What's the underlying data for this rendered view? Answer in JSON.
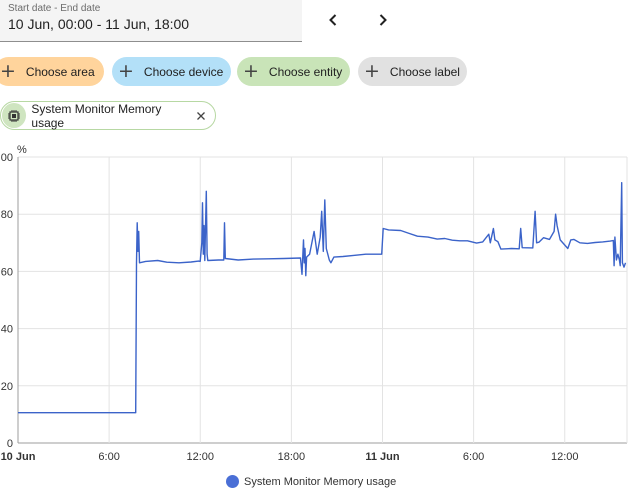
{
  "date_picker": {
    "label": "Start date - End date",
    "value": "10 Jun, 00:00 - 11 Jun, 18:00"
  },
  "chips": [
    {
      "label": "Choose area",
      "color": "#ffd49c"
    },
    {
      "label": "Choose device",
      "color": "#b3e0f8"
    },
    {
      "label": "Choose entity",
      "color": "#c9e4b8"
    },
    {
      "label": "Choose label",
      "color": "#e1e1e1"
    }
  ],
  "selected_entity": {
    "label": "System Monitor Memory usage"
  },
  "chart_data": {
    "type": "line",
    "ylabel": "%",
    "ylim": [
      0,
      100
    ],
    "yticks": [
      0,
      20,
      40,
      60,
      80,
      100
    ],
    "ytick_labels": [
      "0",
      "20",
      "40",
      "60",
      "80",
      "00"
    ],
    "xlim_hours": [
      0,
      40.1
    ],
    "xticks": [
      {
        "hour": 0,
        "label": "10 Jun",
        "bold": true
      },
      {
        "hour": 6,
        "label": "6:00",
        "bold": false
      },
      {
        "hour": 12,
        "label": "12:00",
        "bold": false
      },
      {
        "hour": 18,
        "label": "18:00",
        "bold": false
      },
      {
        "hour": 24,
        "label": "11 Jun",
        "bold": true
      },
      {
        "hour": 30,
        "label": "6:00",
        "bold": false
      },
      {
        "hour": 36,
        "label": "12:00",
        "bold": false
      }
    ],
    "series": [
      {
        "name": "System Monitor Memory usage",
        "color": "#3b63c9",
        "points": [
          [
            0,
            10.6
          ],
          [
            7.75,
            10.6
          ],
          [
            7.8,
            63
          ],
          [
            7.85,
            77
          ],
          [
            7.9,
            67
          ],
          [
            7.95,
            74
          ],
          [
            8.0,
            63
          ],
          [
            8.4,
            63.5
          ],
          [
            9.2,
            63.8
          ],
          [
            9.8,
            63.2
          ],
          [
            10.6,
            63.0
          ],
          [
            11.4,
            63.3
          ],
          [
            11.9,
            63.6
          ],
          [
            12.0,
            63.5
          ],
          [
            12.1,
            70
          ],
          [
            12.15,
            84
          ],
          [
            12.2,
            66
          ],
          [
            12.25,
            76
          ],
          [
            12.3,
            63.8
          ],
          [
            12.4,
            88
          ],
          [
            12.45,
            66
          ],
          [
            12.5,
            63.8
          ],
          [
            13.2,
            64.0
          ],
          [
            13.55,
            64.0
          ],
          [
            13.6,
            77
          ],
          [
            13.65,
            64.5
          ],
          [
            14.5,
            64.0
          ],
          [
            15.5,
            64.3
          ],
          [
            16.5,
            64.4
          ],
          [
            17.5,
            64.5
          ],
          [
            18.6,
            64.7
          ],
          [
            18.7,
            59
          ],
          [
            18.8,
            71
          ],
          [
            18.85,
            63
          ],
          [
            18.9,
            68
          ],
          [
            18.95,
            58.5
          ],
          [
            19.0,
            65
          ],
          [
            19.2,
            66
          ],
          [
            19.5,
            74
          ],
          [
            19.7,
            66
          ],
          [
            19.9,
            72
          ],
          [
            20.0,
            81
          ],
          [
            20.1,
            67
          ],
          [
            20.2,
            85
          ],
          [
            20.25,
            77
          ],
          [
            20.3,
            68
          ],
          [
            20.5,
            64
          ],
          [
            20.6,
            63
          ],
          [
            20.8,
            65.0
          ],
          [
            21.4,
            65.2
          ],
          [
            22.1,
            65.6
          ],
          [
            22.9,
            66.0
          ],
          [
            23.6,
            66.0
          ],
          [
            23.95,
            66.0
          ],
          [
            24.05,
            75
          ],
          [
            24.4,
            74.5
          ],
          [
            25.2,
            74.3
          ],
          [
            25.7,
            73.4
          ],
          [
            26.3,
            72.3
          ],
          [
            27.0,
            72.0
          ],
          [
            27.6,
            71.3
          ],
          [
            28.1,
            71.5
          ],
          [
            28.6,
            70.9
          ],
          [
            29.1,
            70.7
          ],
          [
            29.6,
            70.7
          ],
          [
            30.2,
            69.9
          ],
          [
            30.6,
            70.3
          ],
          [
            31.0,
            73
          ],
          [
            31.1,
            70
          ],
          [
            31.3,
            75
          ],
          [
            31.4,
            71
          ],
          [
            31.6,
            70.4
          ],
          [
            31.8,
            67.8
          ],
          [
            32.5,
            68.0
          ],
          [
            33.0,
            67.9
          ],
          [
            33.1,
            75
          ],
          [
            33.2,
            68.3
          ],
          [
            33.9,
            68.2
          ],
          [
            34.05,
            81
          ],
          [
            34.15,
            70
          ],
          [
            34.3,
            70.2
          ],
          [
            34.6,
            71.8
          ],
          [
            35.0,
            71.2
          ],
          [
            35.3,
            74
          ],
          [
            35.4,
            80
          ],
          [
            35.5,
            76
          ],
          [
            35.7,
            71.0
          ],
          [
            36.2,
            68
          ],
          [
            36.4,
            71
          ],
          [
            36.6,
            71.2
          ],
          [
            37.0,
            70.0
          ],
          [
            37.5,
            69.8
          ],
          [
            38.0,
            70.1
          ],
          [
            38.5,
            70.3
          ],
          [
            39.0,
            70.6
          ],
          [
            39.2,
            70.8
          ],
          [
            39.25,
            62
          ],
          [
            39.3,
            72
          ],
          [
            39.4,
            64
          ],
          [
            39.5,
            66
          ],
          [
            39.6,
            64
          ],
          [
            39.65,
            62
          ],
          [
            39.75,
            91
          ],
          [
            39.8,
            63
          ],
          [
            39.9,
            61.5
          ],
          [
            40.0,
            63
          ]
        ]
      }
    ],
    "legend": {
      "position": "bottom",
      "entries": [
        "System Monitor Memory usage"
      ]
    }
  }
}
